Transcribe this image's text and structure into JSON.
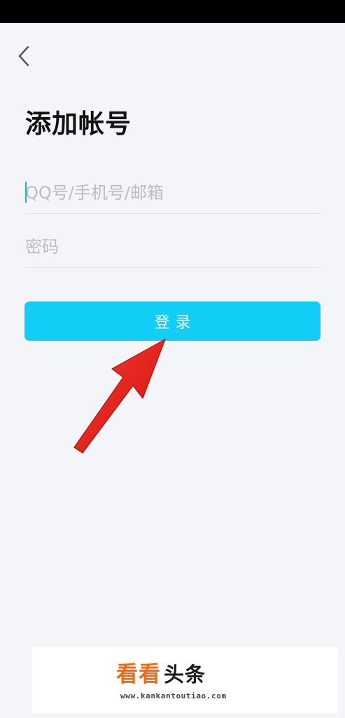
{
  "header": {
    "back_icon": "chevron-left-icon",
    "title": "添加帐号"
  },
  "form": {
    "account": {
      "placeholder": "QQ号/手机号/邮箱",
      "value": ""
    },
    "password": {
      "placeholder": "密码",
      "value": ""
    },
    "login_label": "登录"
  },
  "annotation": {
    "icon": "red-arrow-pointer",
    "color": "#e8201c"
  },
  "watermark": {
    "brand_colored": "看看",
    "brand_dark": "头条",
    "url": "www.kankantoutiao.com"
  },
  "colors": {
    "accent": "#12cdf5",
    "background": "#f4f5f9",
    "status_bar": "#000000",
    "watermark_orange": "#f06a12"
  }
}
